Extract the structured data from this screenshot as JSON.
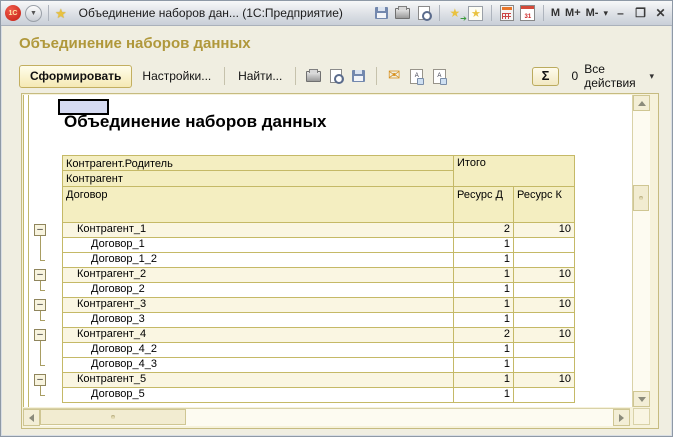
{
  "window": {
    "title": "Объединение наборов дан...  (1С:Предприятие)",
    "logo_text": "1С",
    "memory_buttons": {
      "m": "M",
      "m_plus": "M+",
      "m_minus": "M-"
    },
    "titlebar_icons": [
      "save-icon",
      "print-icon",
      "print-preview-icon",
      "add-to-favorites-icon",
      "favorites-icon",
      "calculator-icon",
      "calendar-icon",
      "more-chevron-icon",
      "minimize",
      "maximize",
      "close"
    ],
    "minimize_glyph": "–",
    "maximize_glyph": "❒",
    "close_glyph": "✕"
  },
  "form": {
    "title": "Объединение наборов данных"
  },
  "toolbar": {
    "generate_label": "Сформировать",
    "settings_label": "Настройки...",
    "find_label": "Найти...",
    "icons": [
      "print-icon",
      "print-preview-icon",
      "save-icon",
      "mail-icon",
      "save-fragment-icon",
      "paste-fragment-icon"
    ],
    "sigma_label": "Σ",
    "sum_value": "0",
    "all_actions_label": "Все действия"
  },
  "report": {
    "title": "Объединение наборов данных",
    "header": {
      "row1_label": "Контрагент.Родитель",
      "row2_label": "Контрагент",
      "row3_label": "Договор",
      "total_label": "Итого",
      "resource_d_label": "Ресурс Д",
      "resource_k_label": "Ресурс К"
    },
    "rows": [
      {
        "label": "Контрагент_1",
        "type": "group",
        "d": "2",
        "k": "10"
      },
      {
        "label": "Договор_1",
        "type": "detail",
        "d": "1",
        "k": ""
      },
      {
        "label": "Договор_1_2",
        "type": "detail",
        "d": "1",
        "k": ""
      },
      {
        "label": "Контрагент_2",
        "type": "group",
        "d": "1",
        "k": "10"
      },
      {
        "label": "Договор_2",
        "type": "detail",
        "d": "1",
        "k": ""
      },
      {
        "label": "Контрагент_3",
        "type": "group",
        "d": "1",
        "k": "10"
      },
      {
        "label": "Договор_3",
        "type": "detail",
        "d": "1",
        "k": ""
      },
      {
        "label": "Контрагент_4",
        "type": "group",
        "d": "2",
        "k": "10"
      },
      {
        "label": "Договор_4_2",
        "type": "detail",
        "d": "1",
        "k": ""
      },
      {
        "label": "Договор_4_3",
        "type": "detail",
        "d": "1",
        "k": ""
      },
      {
        "label": "Контрагент_5",
        "type": "group",
        "d": "1",
        "k": "10"
      },
      {
        "label": "Договор_5",
        "type": "detail",
        "d": "1",
        "k": ""
      }
    ],
    "collapse_glyph": "–"
  },
  "colors": {
    "accent_gold": "#B0983B",
    "table_border": "#C5B967",
    "header_bg": "#F4EEC1",
    "group_row_bg": "#FAF6E2",
    "selected_cell": "#D6DBF2",
    "logo_red": "#C41F12"
  }
}
